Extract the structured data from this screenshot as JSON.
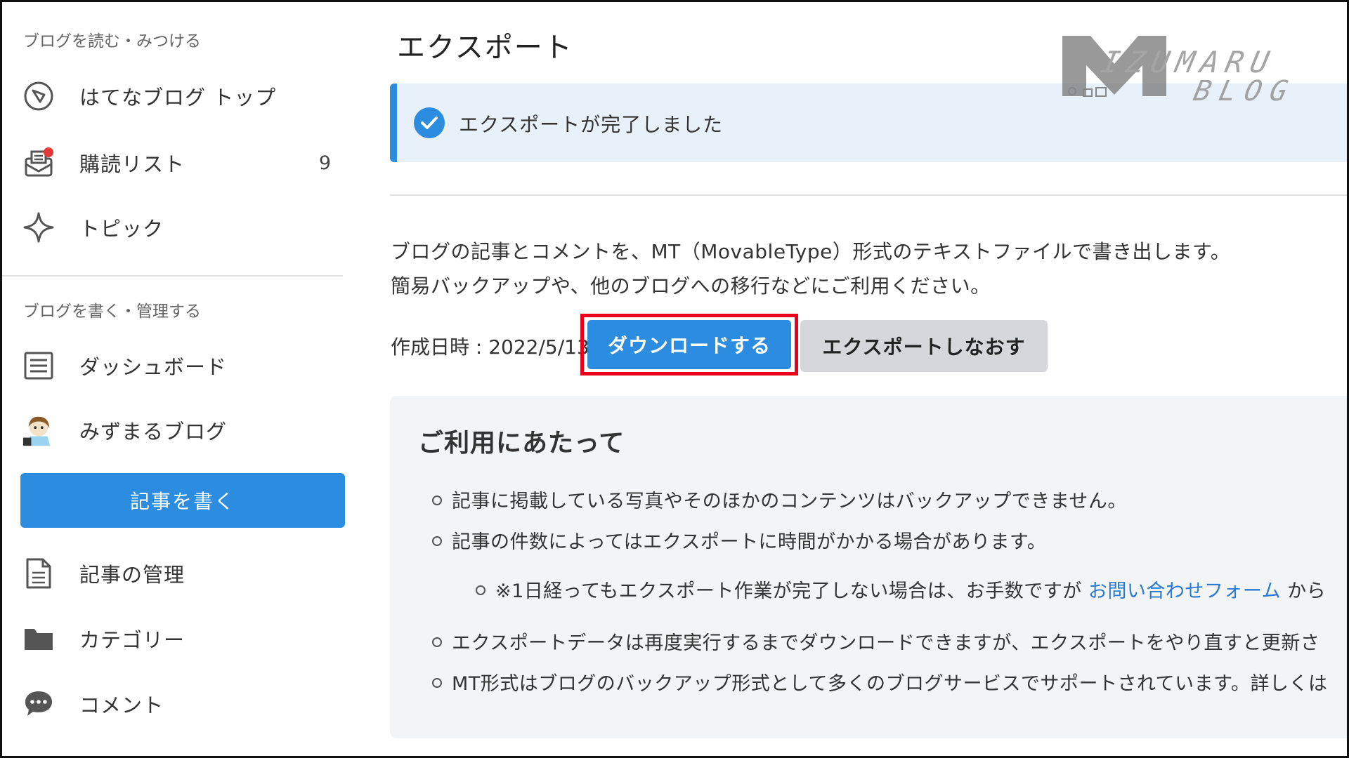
{
  "sidebar": {
    "read_section_title": "ブログを読む・みつける",
    "read_items": [
      {
        "label": "はてなブログ トップ",
        "icon": "compass-icon"
      },
      {
        "label": "購読リスト",
        "icon": "mail-tray-icon",
        "count": "9"
      },
      {
        "label": "トピック",
        "icon": "sparkle-icon"
      }
    ],
    "write_section_title": "ブログを書く・管理する",
    "manage_items_top": [
      {
        "label": "ダッシュボード",
        "icon": "dashboard-icon"
      },
      {
        "label": "みずまるブログ",
        "icon": "blog-avatar"
      }
    ],
    "write_button": "記事を書く",
    "manage_items_bottom": [
      {
        "label": "記事の管理",
        "icon": "document-icon"
      },
      {
        "label": "カテゴリー",
        "icon": "folder-icon"
      },
      {
        "label": "コメント",
        "icon": "comment-icon"
      }
    ]
  },
  "main": {
    "title": "エクスポート",
    "success_message": "エクスポートが完了しました",
    "description": [
      "ブログの記事とコメントを、MT（MovableType）形式のテキストファイルで書き出します。",
      "簡易バックアップや、他のブログへの移行などにご利用ください。"
    ],
    "created_at": "作成日時 : 2022/5/13",
    "download_button": "ダウンロードする",
    "reexport_button": "エクスポートしなおす",
    "notes": {
      "title": "ご利用にあたって",
      "items": [
        "記事に掲載している写真やそのほかのコンテンツはバックアップできません。",
        "記事の件数によってはエクスポートに時間がかかる場合があります。"
      ],
      "sub_item_prefix": "※1日経ってもエクスポート作業が完了しない場合は、お手数ですが ",
      "sub_item_link": "お問い合わせフォーム",
      "sub_item_suffix": " から",
      "items_after": [
        "エクスポートデータは再度実行するまでダウンロードできますが、エクスポートをやり直すと更新さ",
        "MT形式はブログのバックアップ形式として多くのブログサービスでサポートされています。詳しくは"
      ]
    }
  },
  "watermark": {
    "text_line1": "IZUMARU",
    "text_line2": "BLOG"
  },
  "colors": {
    "accent": "#2c8de0",
    "highlight": "#e8001c",
    "success_bg": "#e8f1fa",
    "notes_bg": "#f3f4f5",
    "badge_red": "#e5383b"
  }
}
